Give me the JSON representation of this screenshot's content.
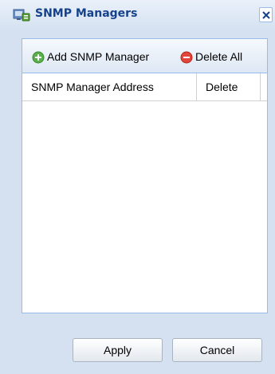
{
  "dialog": {
    "title": "SNMP Managers",
    "title_icon": "snmp-manager-icon",
    "close_icon": "close-icon"
  },
  "toolbar": {
    "add_label": "Add SNMP Manager",
    "add_icon": "plus-circle-icon",
    "delete_all_label": "Delete All",
    "delete_all_icon": "minus-circle-icon"
  },
  "grid": {
    "columns": [
      "SNMP Manager Address",
      "Delete"
    ],
    "rows": []
  },
  "footer": {
    "apply_label": "Apply",
    "cancel_label": "Cancel"
  },
  "colors": {
    "title_text": "#15428b",
    "dialog_bg": "#d5e1f0",
    "border": "#99bbe8"
  }
}
